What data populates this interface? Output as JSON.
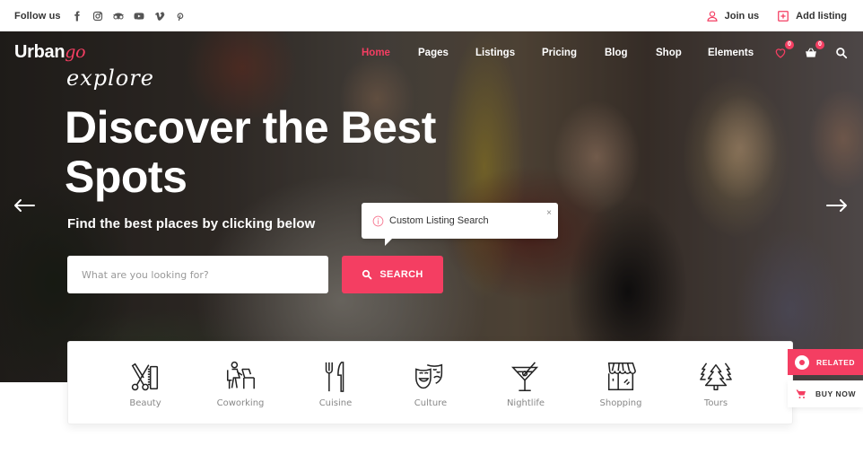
{
  "topbar": {
    "follow_label": "Follow us",
    "social_icons": [
      "facebook-icon",
      "instagram-icon",
      "tripadvisor-icon",
      "youtube-icon",
      "vimeo-icon",
      "pinterest-icon"
    ],
    "join_label": "Join us",
    "add_listing_label": "Add listing"
  },
  "brand": {
    "name_main": "Urban",
    "name_accent": "go",
    "accent_color": "#f43e62"
  },
  "nav": {
    "items": [
      {
        "label": "Home",
        "active": true
      },
      {
        "label": "Pages",
        "active": false
      },
      {
        "label": "Listings",
        "active": false
      },
      {
        "label": "Pricing",
        "active": false
      },
      {
        "label": "Blog",
        "active": false
      },
      {
        "label": "Shop",
        "active": false
      },
      {
        "label": "Elements",
        "active": false
      }
    ],
    "wishlist_count": "0",
    "cart_count": "0"
  },
  "hero": {
    "script_label": "explore",
    "title": "Discover the Best Spots",
    "subtitle": "Find the best places by clicking below",
    "search_placeholder": "What are you looking for?",
    "search_button": "SEARCH",
    "tooltip_text": "Custom Listing Search",
    "tooltip_close": "×"
  },
  "categories": [
    {
      "label": "Beauty",
      "icon": "scissors-comb-icon"
    },
    {
      "label": "Coworking",
      "icon": "person-at-desk-icon"
    },
    {
      "label": "Cuisine",
      "icon": "fork-knife-icon"
    },
    {
      "label": "Culture",
      "icon": "theater-masks-icon"
    },
    {
      "label": "Nightlife",
      "icon": "cocktail-icon"
    },
    {
      "label": "Shopping",
      "icon": "storefront-icon"
    },
    {
      "label": "Tours",
      "icon": "pine-trees-icon"
    }
  ],
  "side": {
    "related_label": "RELATED",
    "buy_now_label": "BUY NOW"
  }
}
